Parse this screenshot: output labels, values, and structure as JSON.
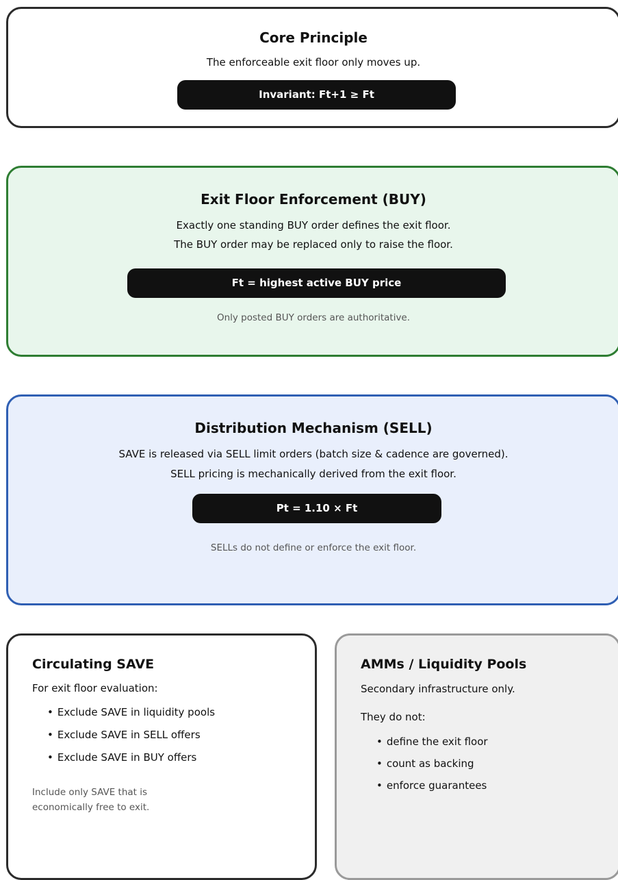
{
  "core": {
    "title": "Core Principle",
    "line1": "The enforceable exit floor only moves up.",
    "invariant": "Invariant: Ft+1 ≥ Ft"
  },
  "buy": {
    "title": "Exit Floor Enforcement (BUY)",
    "line1": "Exactly one standing BUY order defines the exit floor.",
    "line2": "The BUY order may be replaced only to raise the floor.",
    "formula": "Ft = highest active BUY price",
    "note": "Only posted BUY orders are authoritative.",
    "border_color": "#2e7d32",
    "background": "#e8f6ec"
  },
  "sell": {
    "title": "Distribution Mechanism (SELL)",
    "line1": "SAVE is released via SELL limit orders (batch size & cadence are governed).",
    "line2": "SELL pricing is mechanically derived from the exit floor.",
    "formula": "Pt = 1.10 × Ft",
    "note": "SELLs do not define or enforce the exit floor.",
    "border_color": "#2f5fb3",
    "background": "#e9effc"
  },
  "circulating": {
    "title": "Circulating SAVE",
    "intro": "For exit floor evaluation:",
    "items": [
      "Exclude SAVE in liquidity pools",
      "Exclude SAVE in SELL offers",
      "Exclude SAVE in BUY offers"
    ],
    "foot_line1": "Include only SAVE that is",
    "foot_line2": "economically free to exit."
  },
  "amm": {
    "title": "AMMs / Liquidity Pools",
    "intro": "Secondary infrastructure only.",
    "intro2": "They do not:",
    "items": [
      "define the exit floor",
      "count as backing",
      "enforce guarantees"
    ],
    "background": "#f0f0f0"
  },
  "bullet": "•"
}
